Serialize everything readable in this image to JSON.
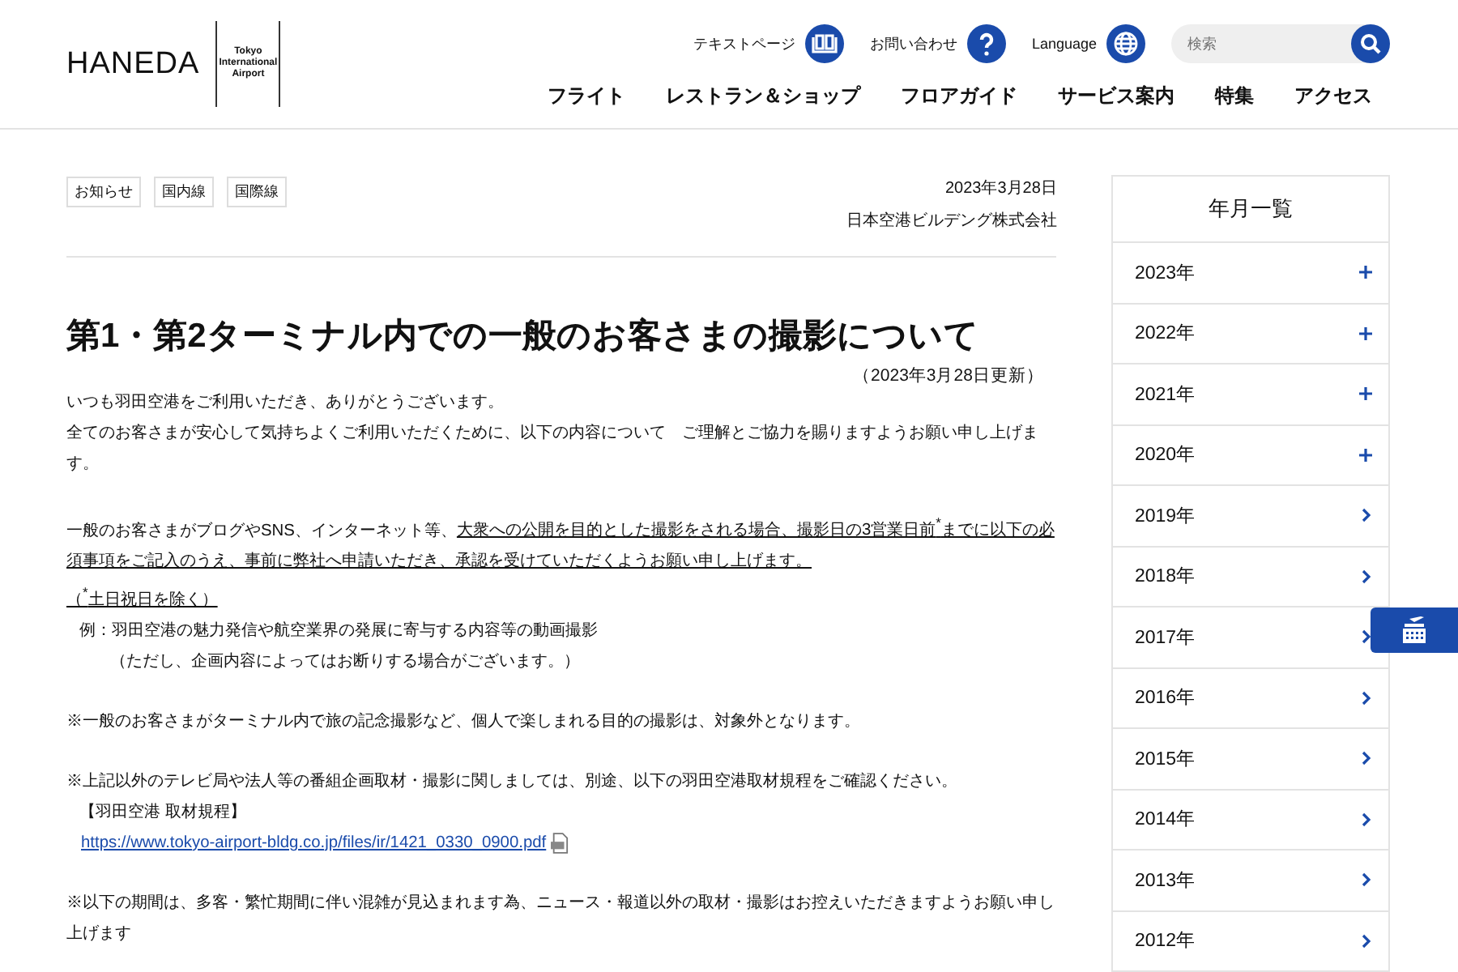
{
  "logo": {
    "wordmark": "HANEDA",
    "sub": "Tokyo International Airport"
  },
  "utility_links": [
    {
      "label": "テキストページ",
      "kind": "book"
    },
    {
      "label": "お問い合わせ",
      "kind": "question"
    },
    {
      "label": "Language",
      "kind": "globe"
    }
  ],
  "search": {
    "placeholder": "検索"
  },
  "nav": [
    "フライト",
    "レストラン＆ショップ",
    "フロアガイド",
    "サービス案内",
    "特集",
    "アクセス"
  ],
  "article": {
    "tags": [
      "お知らせ",
      "国内線",
      "国際線"
    ],
    "date": "2023年3月28日",
    "publisher": "日本空港ビルデング株式会社",
    "title": "第1・第2ターミナル内での一般のお客さまの撮影について",
    "updated": "（2023年3月28日更新）",
    "sections": [
      [
        {
          "kind": "text",
          "segments": [
            {
              "text": "いつも羽田空港をご利用いただき、ありがとうございます。",
              "underline": false
            }
          ]
        },
        {
          "kind": "text",
          "segments": [
            {
              "text": "全てのお客さまが安心して気持ちよくご利用いただくために、以下の内容について　ご理解とご協力を賜りますようお願い申し上げます。",
              "underline": false
            }
          ]
        }
      ],
      [
        {
          "kind": "text",
          "segments": [
            {
              "text": "一般のお客さまがブログやSNS、インターネット等、",
              "underline": false
            },
            {
              "text": "大衆への公開を目的とした撮影をされる場合、撮影日の3営業日前$^{*}$までに以下の必須事項をご記入のうえ、事前に弊社へ申請いただき、承認を受けていただくようお願い申し上げます。",
              "underline": true
            }
          ]
        },
        {
          "kind": "text",
          "segments": [
            {
              "text": "（$^{*}$土日祝日を除く）",
              "underline": true
            }
          ]
        },
        {
          "kind": "indent",
          "segments": [
            {
              "text": "例：羽田空港の魅力発信や航空業界の発展に寄与する内容等の動画撮影",
              "underline": false
            }
          ]
        },
        {
          "kind": "subindent",
          "segments": [
            {
              "text": "（ただし、企画内容によってはお断りする場合がございます。）",
              "underline": false
            }
          ]
        }
      ],
      [
        {
          "kind": "text",
          "segments": [
            {
              "text": "※一般のお客さまがターミナル内で旅の記念撮影など、個人で楽しまれる目的の撮影は、対象外となります。",
              "underline": false
            }
          ]
        }
      ],
      [
        {
          "kind": "text",
          "segments": [
            {
              "text": "※上記以外のテレビ局や法人等の番組企画取材・撮影に関しましては、別途、以下の羽田空港取材規程をご確認ください。",
              "underline": false
            }
          ]
        },
        {
          "kind": "indent",
          "segments": [
            {
              "text": "【羽田空港 取材規程】",
              "underline": false
            }
          ]
        },
        {
          "kind": "link",
          "segments": [
            {
              "text": "https://www.tokyo-airport-bldg.co.jp/files/ir/1421_0330_0900.pdf",
              "underline": true
            }
          ]
        }
      ],
      [
        {
          "kind": "text",
          "segments": [
            {
              "text": "※以下の期間は、多客・繁忙期間に伴い混雑が見込まれます為、ニュース・報道以外の取材・撮影はお控えいただきますようお願い申し上げます",
              "underline": false
            }
          ]
        }
      ]
    ]
  },
  "sidebar": {
    "title": "年月一覧",
    "items": [
      {
        "label": "2023年",
        "kind": "expand"
      },
      {
        "label": "2022年",
        "kind": "expand"
      },
      {
        "label": "2021年",
        "kind": "expand"
      },
      {
        "label": "2020年",
        "kind": "expand"
      },
      {
        "label": "2019年",
        "kind": "link"
      },
      {
        "label": "2018年",
        "kind": "link"
      },
      {
        "label": "2017年",
        "kind": "link"
      },
      {
        "label": "2016年",
        "kind": "link"
      },
      {
        "label": "2015年",
        "kind": "link"
      },
      {
        "label": "2014年",
        "kind": "link"
      },
      {
        "label": "2013年",
        "kind": "link"
      },
      {
        "label": "2012年",
        "kind": "link"
      }
    ]
  }
}
